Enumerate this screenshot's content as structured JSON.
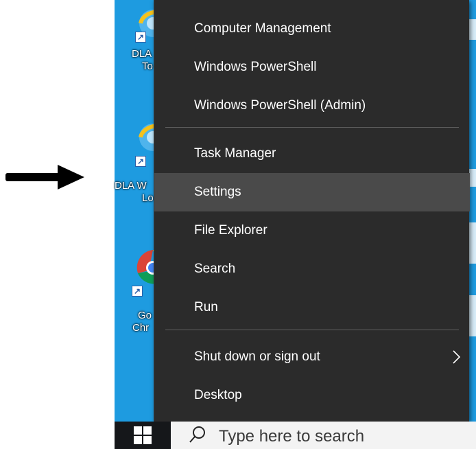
{
  "menu": {
    "items": [
      {
        "label": "Computer Management"
      },
      {
        "label": "Windows PowerShell"
      },
      {
        "label": "Windows PowerShell (Admin)"
      },
      {
        "label": "Task Manager"
      },
      {
        "label": "Settings",
        "highlighted": true
      },
      {
        "label": "File Explorer"
      },
      {
        "label": "Search"
      },
      {
        "label": "Run"
      },
      {
        "label": "Shut down or sign out",
        "has_submenu": true
      },
      {
        "label": "Desktop"
      }
    ]
  },
  "desktop": {
    "icons": [
      {
        "label_line1": "DLA",
        "label_line2": "To",
        "icon": "internet-explorer-icon"
      },
      {
        "label_line1": "DLA W",
        "label_line2": "Lo",
        "icon": "internet-explorer-icon"
      },
      {
        "label_line1": "Go",
        "label_line2": "Chr",
        "icon": "chrome-icon"
      }
    ]
  },
  "taskbar": {
    "search_placeholder": "Type here to search"
  },
  "colors": {
    "desktop": "#1e9be0",
    "menu_bg": "#2b2b2b",
    "menu_highlight": "#4a4a4a",
    "taskbar": "#15171a"
  }
}
